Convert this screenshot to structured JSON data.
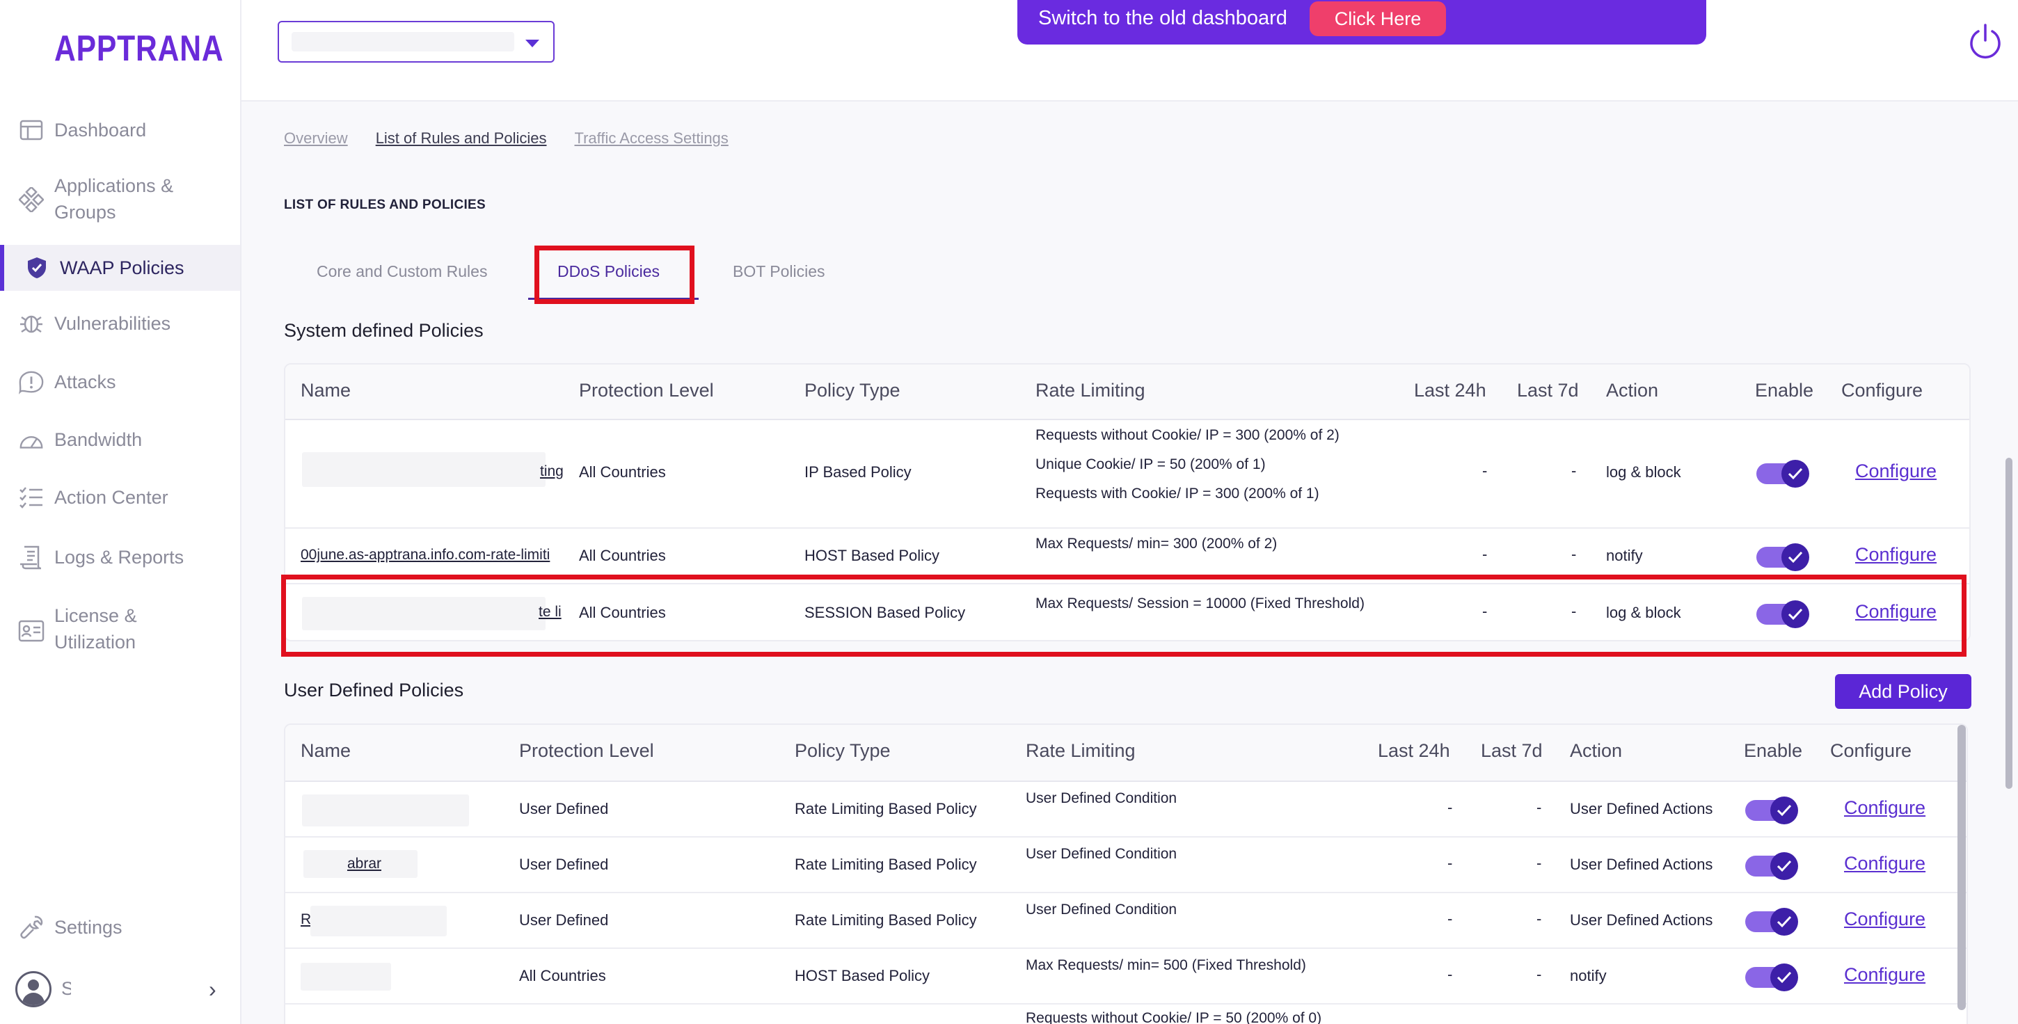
{
  "brand": {
    "logo": "APPTRANA"
  },
  "sidebar": {
    "items": [
      {
        "label": "Dashboard",
        "icon": "dashboard-icon"
      },
      {
        "label": "Applications &",
        "label2": "Groups",
        "icon": "applications-icon"
      },
      {
        "label": "WAAP Policies",
        "icon": "shield-icon"
      },
      {
        "label": "Vulnerabilities",
        "icon": "bug-icon"
      },
      {
        "label": "Attacks",
        "icon": "alert-icon"
      },
      {
        "label": "Bandwidth",
        "icon": "gauge-icon"
      },
      {
        "label": "Action Center",
        "icon": "list-icon"
      },
      {
        "label": "Logs & Reports",
        "icon": "report-icon"
      },
      {
        "label": "License &",
        "label2": "Utilization",
        "icon": "license-icon"
      },
      {
        "label": "Settings",
        "icon": "wrench-icon"
      }
    ],
    "user_initial": "S"
  },
  "topbar": {
    "switch_text": "Switch to the old dashboard",
    "click_here": "Click Here"
  },
  "subnav": {
    "overview": "Overview",
    "rules": "List of Rules and Policies",
    "traffic": "Traffic Access Settings"
  },
  "section_caption": "LIST OF RULES AND POLICIES",
  "tabs": {
    "core": "Core and Custom Rules",
    "ddos": "DDoS Policies",
    "bot": "BOT Policies"
  },
  "system": {
    "heading": "System defined Policies",
    "columns": [
      "Name",
      "Protection Level",
      "Policy Type",
      "Rate Limiting",
      "Last 24h",
      "Last 7d",
      "Action",
      "Enable",
      "Configure"
    ],
    "rows": [
      {
        "name_tail": "ting",
        "level": "All Countries",
        "type": "IP Based Policy",
        "rate": [
          "Requests without Cookie/ IP = 300 (200% of 2)",
          "Unique Cookie/ IP = 50 (200% of 1)",
          "Requests with Cookie/ IP = 300 (200% of 1)"
        ],
        "last24": "-",
        "last7": "-",
        "action": "log & block",
        "configure": "Configure"
      },
      {
        "name_tail": "00june.as-apptrana.info.com-rate-limiti",
        "level": "All Countries",
        "type": "HOST Based Policy",
        "rate": [
          "Max Requests/ min= 300 (200% of 2)"
        ],
        "last24": "-",
        "last7": "-",
        "action": "notify",
        "configure": "Configure"
      },
      {
        "name_tail": "te li",
        "level": "All Countries",
        "type": "SESSION Based Policy",
        "rate": [
          "Max Requests/ Session = 10000 (Fixed Threshold)"
        ],
        "last24": "-",
        "last7": "-",
        "action": "log & block",
        "configure": "Configure"
      }
    ]
  },
  "user": {
    "heading": "User Defined Policies",
    "add_button": "Add Policy",
    "columns": [
      "Name",
      "Protection Level",
      "Policy Type",
      "Rate Limiting",
      "Last 24h",
      "Last 7d",
      "Action",
      "Enable",
      "Configure"
    ],
    "rows": [
      {
        "name_tail": "",
        "level": "User Defined",
        "type": "Rate Limiting Based Policy",
        "rate": [
          "User Defined Condition"
        ],
        "last24": "-",
        "last7": "-",
        "action": "User Defined Actions",
        "configure": "Configure"
      },
      {
        "name_tail": "abrar",
        "level": "User Defined",
        "type": "Rate Limiting Based Policy",
        "rate": [
          "User Defined Condition"
        ],
        "last24": "-",
        "last7": "-",
        "action": "User Defined Actions",
        "configure": "Configure"
      },
      {
        "name_tail": "R",
        "level": "User Defined",
        "type": "Rate Limiting Based Policy",
        "rate": [
          "User Defined Condition"
        ],
        "last24": "-",
        "last7": "-",
        "action": "User Defined Actions",
        "configure": "Configure"
      },
      {
        "name_tail": "",
        "level": "All Countries",
        "type": "HOST Based Policy",
        "rate": [
          "Max Requests/ min= 500 (Fixed Threshold)"
        ],
        "last24": "-",
        "last7": "-",
        "action": "notify",
        "configure": "Configure"
      },
      {
        "name_tail": "",
        "level": "",
        "type": "",
        "rate": [
          "Requests without Cookie/ IP = 50 (200% of 0)"
        ],
        "last24": "",
        "last7": "",
        "action": "",
        "configure": ""
      }
    ]
  },
  "colors": {
    "accent": "#5b26d6",
    "highlight": "#e0101e",
    "banner": "#6a2be0",
    "cta": "#ef3f6b"
  }
}
